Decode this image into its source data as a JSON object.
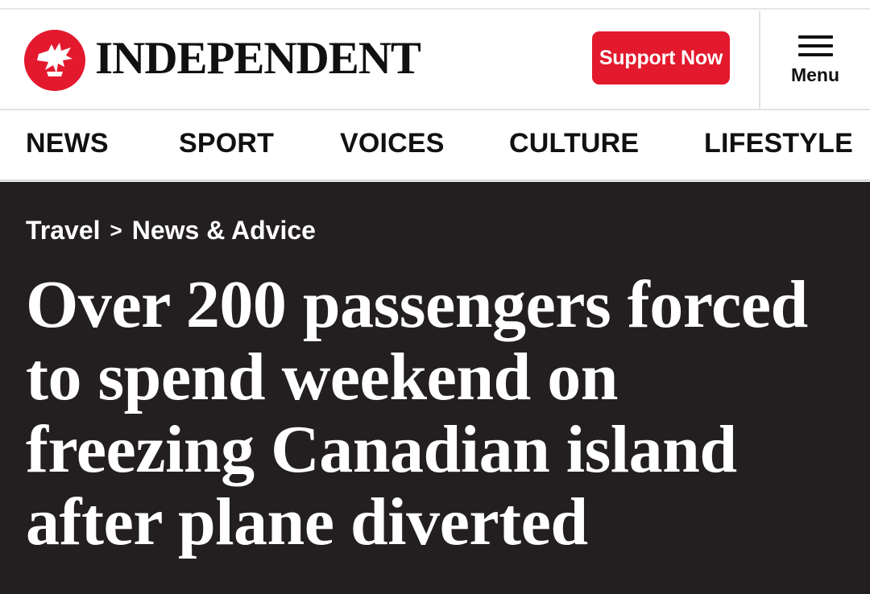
{
  "masthead": {
    "brand": "INDEPENDENT",
    "support_label": "Support Now",
    "menu_label": "Menu",
    "brand_color": "#e3192d",
    "logo_icon": "eagle-logo-icon",
    "menu_icon": "hamburger-icon"
  },
  "nav": {
    "items": [
      "NEWS",
      "SPORT",
      "VOICES",
      "CULTURE",
      "LIFESTYLE"
    ]
  },
  "article": {
    "breadcrumb": [
      "Travel",
      "News & Advice"
    ],
    "breadcrumb_separator": ">",
    "headline": "Over 200 passengers forced to spend weekend on freezing Canadian island after plane diverted",
    "background_color": "#231f20"
  }
}
